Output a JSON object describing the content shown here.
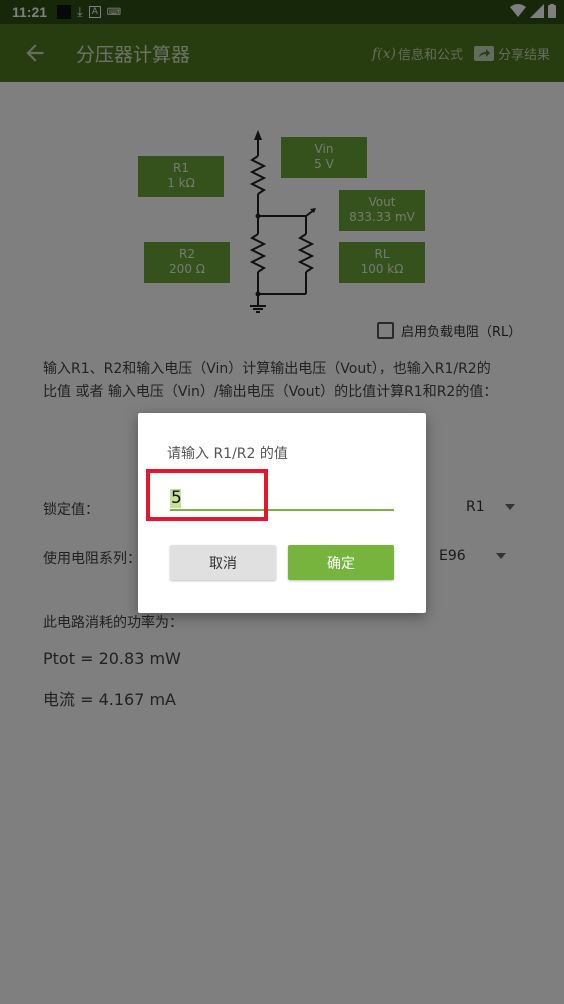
{
  "statusbar": {
    "time": "11:21"
  },
  "appbar": {
    "title": "分压器计算器",
    "info_fx": "f(x)",
    "info_label": "信息和公式",
    "share_label": "分享结果"
  },
  "circuit": {
    "r1": {
      "name": "R1",
      "value": "1 kΩ"
    },
    "vin": {
      "name": "Vin",
      "value": "5 V"
    },
    "vout": {
      "name": "Vout",
      "value": "833.33 mV"
    },
    "r2": {
      "name": "R2",
      "value": "200 Ω"
    },
    "rl": {
      "name": "RL",
      "value": "100 kΩ"
    }
  },
  "load_checkbox_label": "启用负载电阻（RL）",
  "description_line1": "输入R1、R2和输入电压（Vin）计算输出电压（Vout），也输入R1/R2的",
  "description_line2": "比值 或者 输入电压（Vin）/输出电压（Vout）的比值计算R1和R2的值：",
  "lock": {
    "label": "锁定值：",
    "value": "R1"
  },
  "series": {
    "label": "使用电阻系列：",
    "value": "E96"
  },
  "power": {
    "title": "此电路消耗的功率为：",
    "ptot": "Ptot = 20.83 mW",
    "current": "电流 = 4.167 mA"
  },
  "dialog": {
    "title": "请输入 R1/R2 的值",
    "input_value": "5",
    "cancel_label": "取消",
    "ok_label": "确定"
  },
  "colors": {
    "appbar": "#4f7a1f",
    "statusbar": "#2f4f13",
    "accent": "#76b43e",
    "highlight": "#e3162d"
  }
}
